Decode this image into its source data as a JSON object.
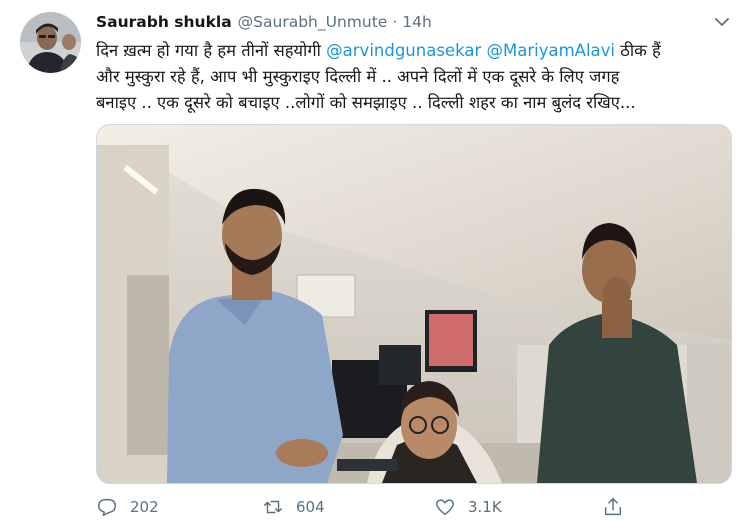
{
  "tweet": {
    "author_name": "Saurabh shukla",
    "handle": "@Saurabh_Unmute",
    "separator": "·",
    "time": "14h",
    "text": {
      "line1_before": "दिन ख़त्म हो गया है हम तीनों सहयोगी ",
      "mention1": "@arvindgunasekar",
      "line1_mid": " ",
      "mention2": "@MariyamAlavi",
      "line1_after": " ठीक हैं",
      "line2": "और मुस्कुरा रहे हैं, आप भी मुस्कुराइए दिल्ली में .. अपने दिलों में एक दूसरे के लिए जगह",
      "line3": "बनाइए .. एक दूसरे को बचाइए ..लोगों को समझाइए .. दिल्ली शहर का नाम बुलंद रखिए..."
    },
    "media": {
      "description_icon": "office-photo"
    },
    "actions": {
      "reply_count": "202",
      "retweet_count": "604",
      "like_count": "3.1K"
    }
  },
  "colors": {
    "link": "#1b95e0",
    "secondary_text": "#5b7083",
    "primary_text": "#14171a",
    "border": "#cfd9de"
  },
  "icons": {
    "reply": "reply-icon",
    "retweet": "retweet-icon",
    "like": "like-icon",
    "share": "share-icon",
    "more": "chevron-down-icon"
  }
}
